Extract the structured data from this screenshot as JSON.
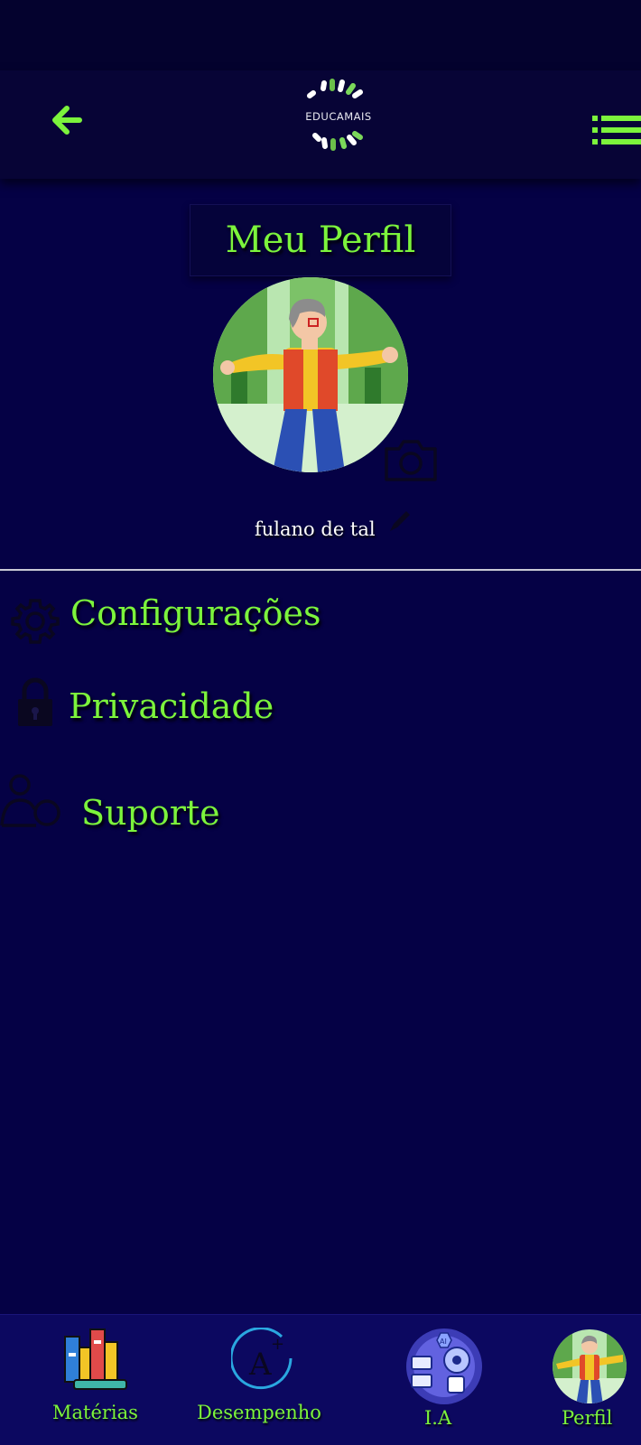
{
  "header": {
    "logo_text": "EDUCAMAIS",
    "back_icon": "arrow-left-icon",
    "menu_icon": "list-menu-icon"
  },
  "profile": {
    "title": "Meu Perfil",
    "username": "fulano de tal",
    "camera_icon": "camera-icon",
    "edit_icon": "pencil-icon"
  },
  "menu": {
    "items": [
      {
        "label": "Configurações",
        "icon": "gear-icon"
      },
      {
        "label": "Privacidade",
        "icon": "lock-icon"
      },
      {
        "label": "Suporte",
        "icon": "support-users-icon"
      }
    ]
  },
  "bottom_nav": {
    "items": [
      {
        "label": "Matérias",
        "icon": "books-icon"
      },
      {
        "label": "Desempenho",
        "icon": "grade-a-plus-icon"
      },
      {
        "label": "I.A",
        "icon": "ai-robot-icon"
      },
      {
        "label": "Perfil",
        "icon": "profile-avatar-icon"
      }
    ]
  },
  "colors": {
    "background": "#050145",
    "accent_green": "#7cf43c",
    "nav_background": "#0c0860"
  }
}
